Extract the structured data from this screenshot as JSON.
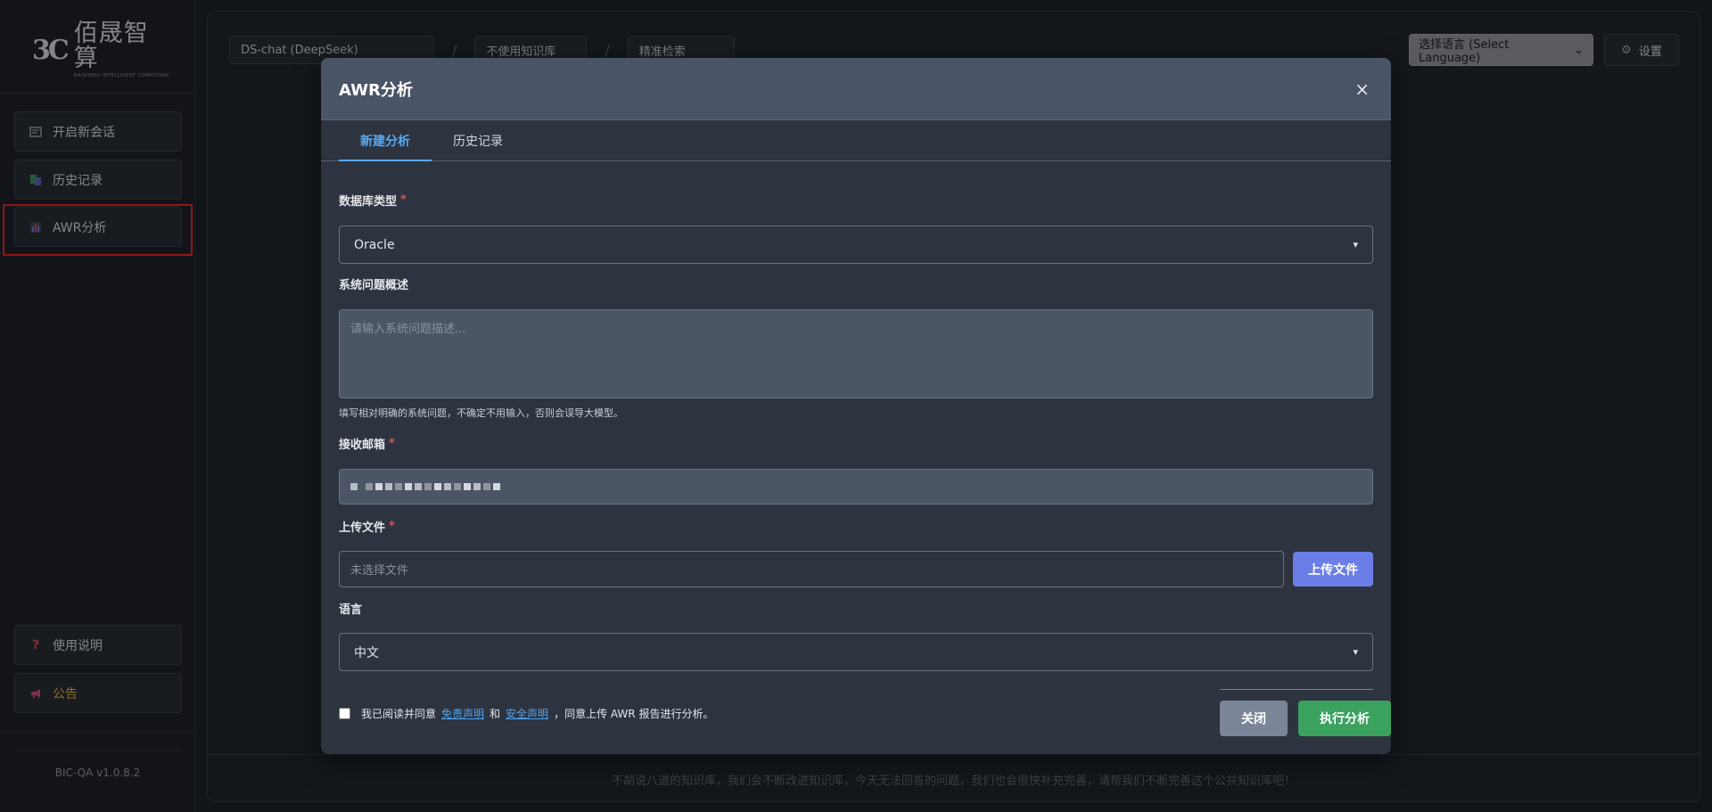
{
  "sidebar": {
    "logo_mark": "3C",
    "logo_cn": "佰晟智算",
    "logo_en": "BAISHENG INTELLIGENT COMPUTING",
    "items": [
      {
        "label": "开启新会话",
        "icon": "chat-icon"
      },
      {
        "label": "历史记录",
        "icon": "history-icon"
      },
      {
        "label": "AWR分析",
        "icon": "chart-icon"
      }
    ],
    "bottom_items": [
      {
        "label": "使用说明",
        "icon": "question-icon"
      },
      {
        "label": "公告",
        "icon": "megaphone-icon"
      }
    ],
    "version": "BIC-QA v1.0.8.2"
  },
  "topbar": {
    "model": "DS-chat (DeepSeek)",
    "sep": "/",
    "knowledge": "不使用知识库",
    "search_mode": "精准检索",
    "language_select": "选择语言 (Select Language)",
    "settings": "设置"
  },
  "footer": {
    "text": "不胡说八道的知识库，我们会不断改进知识库，今天无法回答的问题，我们也会很快补充完善，请帮我们不断完善这个公共知识库吧！"
  },
  "modal": {
    "title": "AWR分析",
    "close": "×",
    "tabs": [
      "新建分析",
      "历史记录"
    ],
    "db_type": {
      "label": "数据库类型",
      "required": "*",
      "value": "Oracle"
    },
    "problem": {
      "label": "系统问题概述",
      "placeholder": "请输入系统问题描述...",
      "hint": "填写相对明确的系统问题，不确定不用输入，否则会误导大模型。"
    },
    "email": {
      "label": "接收邮箱",
      "required": "*"
    },
    "upload": {
      "label": "上传文件",
      "required": "*",
      "placeholder": "未选择文件",
      "button": "上传文件"
    },
    "language": {
      "label": "语言",
      "value": "中文"
    },
    "agree": {
      "prefix": "我已阅读并同意",
      "link1": "免责声明",
      "and": "和",
      "link2": "安全声明",
      "suffix": "，同意上传 AWR 报告进行分析。"
    },
    "buttons": {
      "close": "关闭",
      "run": "执行分析"
    }
  },
  "colors": {
    "accent_blue": "#5aa9f0",
    "upload_button": "#6b7ee8",
    "run_button": "#3aa15f",
    "close_button": "#7a8698",
    "highlight_red": "#e02424"
  }
}
